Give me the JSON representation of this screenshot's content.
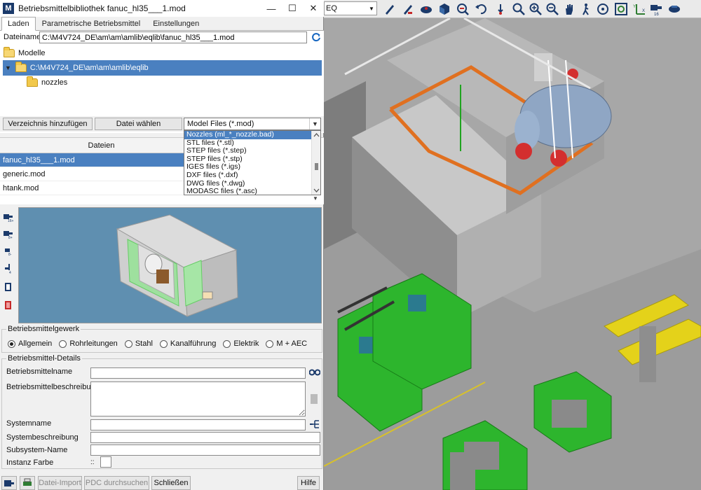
{
  "window": {
    "title": "Betriebsmittelbibliothek fanuc_hl35___1.mod",
    "app_icon": "M",
    "minimize": "—",
    "maximize": "☐",
    "close": "✕"
  },
  "tabs": [
    {
      "label": "Laden",
      "active": true
    },
    {
      "label": "Parametrische Betriebsmittel",
      "active": false
    },
    {
      "label": "Einstellungen",
      "active": false
    }
  ],
  "load": {
    "filename_label": "Dateiname",
    "filename_value": "C:\\M4V724_DE\\am\\am\\amlib\\eqlib\\fanuc_hl35___1.mod",
    "tree": {
      "root": "Modelle",
      "selected_path": "C:\\M4V724_DE\\am\\am\\amlib\\eqlib",
      "child": "nozzles"
    },
    "add_dir_button": "Verzeichnis hinzufügen",
    "choose_file_button": "Datei wählen",
    "filter_value": "Model Files (*.mod)",
    "filter_options": [
      "Nozzles (ml_*_nozzle.bad)",
      "STL files (*.stl)",
      "STEP files (*.step)",
      "STEP files (*.stp)",
      "IGES files (*.igs)",
      "DXF files (*.dxf)",
      "DWG files (*.dwg)",
      "MODASC files (*.asc)"
    ]
  },
  "files": {
    "header": "Dateien",
    "rows": [
      "fanuc_hl35___1.mod",
      "generic.mod",
      "htank.mod"
    ]
  },
  "gewerk": {
    "title": "Betriebsmittelgewerk",
    "options": [
      "Allgemein",
      "Rohrleitungen",
      "Stahl",
      "Kanalführung",
      "Elektrik",
      "M + AEC"
    ],
    "selected": "Allgemein"
  },
  "details": {
    "title": "Betriebsmittel-Details",
    "name_label": "Betriebsmittelname",
    "desc_label": "Betriebsmittelbeschreibung",
    "system_label": "Systemname",
    "system_desc_label": "Systembeschreibung",
    "subsystem_label": "Subsystem-Name",
    "color_label": "Instanz Farbe",
    "color_dots": "::"
  },
  "bottom": {
    "import_button": "Datei-Import",
    "pdc_button": "PDC durchsuchen",
    "close_button": "Schließen",
    "help_button": "Hilfe"
  },
  "viewport": {
    "view_select": "EQ"
  },
  "colors": {
    "selection": "#4a80c0",
    "preview_bg": "#5f8fb0",
    "equipment_green": "#2db52d",
    "pipe_orange": "#e07020",
    "beam_yellow": "#e4d21a"
  }
}
